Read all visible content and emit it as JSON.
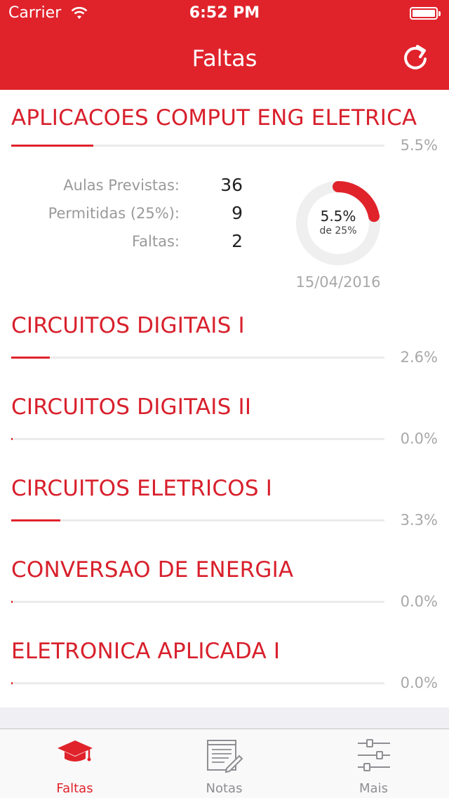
{
  "status": {
    "carrier": "Carrier",
    "time": "6:52 PM"
  },
  "nav": {
    "title": "Faltas",
    "refresh_icon": "refresh-icon"
  },
  "colors": {
    "accent": "#e0232b",
    "text_red": "#d8202c",
    "muted": "#a8a8a8",
    "track": "#ebebeb"
  },
  "courses": [
    {
      "name": "APLICACOES COMPUT ENG ELETRICA",
      "percent": "5.5%",
      "fill_fraction": 0.22,
      "expanded": true,
      "details": {
        "labels": [
          "Aulas Previstas:",
          "Permitidas (25%):",
          "Faltas:"
        ],
        "values": [
          "36",
          "9",
          "2"
        ],
        "donut_percent": "5.5%",
        "donut_sub": "de 25%",
        "donut_fraction": 0.22,
        "date": "15/04/2016"
      }
    },
    {
      "name": "CIRCUITOS DIGITAIS I",
      "percent": "2.6%",
      "fill_fraction": 0.104
    },
    {
      "name": "CIRCUITOS DIGITAIS II",
      "percent": "0.0%",
      "fill_fraction": 0.0
    },
    {
      "name": "CIRCUITOS ELETRICOS I",
      "percent": "3.3%",
      "fill_fraction": 0.132
    },
    {
      "name": "CONVERSAO DE ENERGIA",
      "percent": "0.0%",
      "fill_fraction": 0.0
    },
    {
      "name": "ELETRONICA APLICADA I",
      "percent": "0.0%",
      "fill_fraction": 0.0
    }
  ],
  "tabs": [
    {
      "label": "Faltas",
      "icon": "graduation-cap-icon",
      "active": true
    },
    {
      "label": "Notas",
      "icon": "notepad-edit-icon",
      "active": false
    },
    {
      "label": "Mais",
      "icon": "sliders-icon",
      "active": false
    }
  ]
}
